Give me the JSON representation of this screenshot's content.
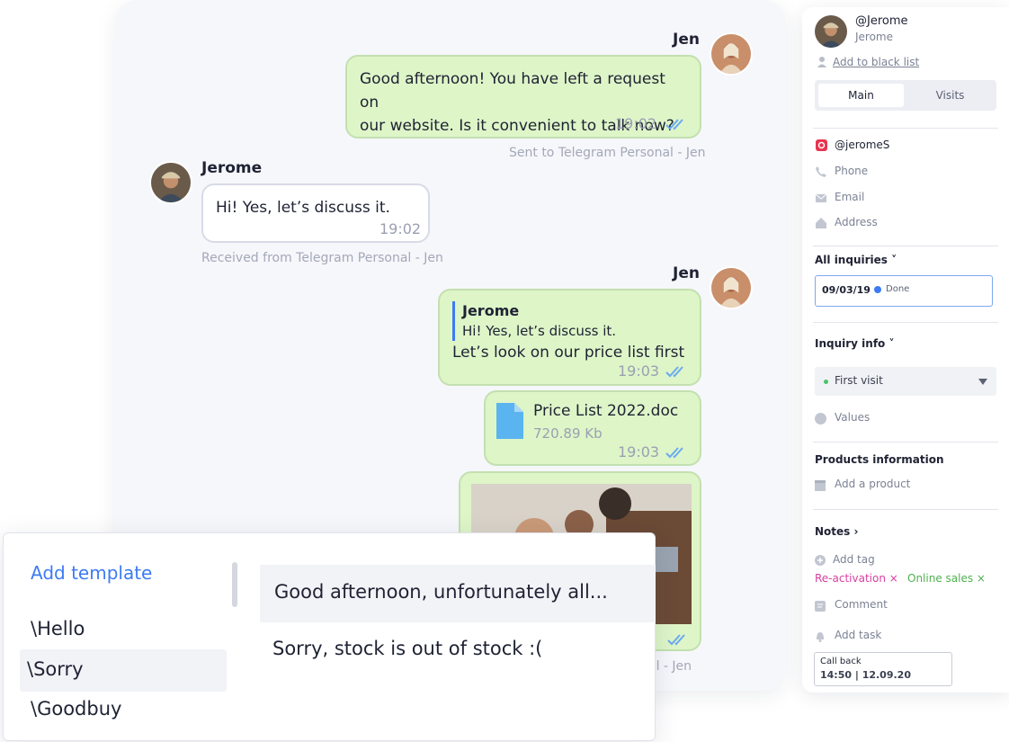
{
  "chat": {
    "messages": [
      {
        "sender": "Jen",
        "text": "Good afternoon! You have left a request on our website. Is it convenient to talk now?",
        "line1": "Good afternoon! You have left a request on",
        "line2": "our website. Is it convenient to talk now?",
        "time": "19:02",
        "meta": "Sent to Telegram Personal - Jen"
      },
      {
        "sender": "Jerome",
        "text": "Hi! Yes, let’s discuss it.",
        "time": "19:02",
        "meta": "Received from Telegram Personal - Jen"
      },
      {
        "sender": "Jen",
        "quote_author": "Jerome",
        "quote_text": "Hi! Yes, let’s discuss it.",
        "text": "Let’s look on our price list first",
        "time": "19:03"
      },
      {
        "file_name": "Price List 2022.doc",
        "file_size": "720.89 Kb",
        "time": "19:03"
      },
      {
        "meta_partial": "al - Jen"
      }
    ]
  },
  "sidebar": {
    "handle": "@Jerome",
    "name": "Jerome",
    "blacklist": "Add to black list",
    "tabs": [
      "Main",
      "Visits"
    ],
    "contacts": {
      "instagram": "@jeromeS",
      "phone": "Phone",
      "email": "Email",
      "address": "Address"
    },
    "inquiries_title": "All inquiries ˅",
    "inquiry": {
      "date": "09/03/19",
      "status": "Done"
    },
    "inquiry_info_title": "Inquiry info ˅",
    "visit_select": "First visit",
    "values": "Values",
    "products_title": "Products information",
    "add_product": "Add a product",
    "notes_title": "Notes ›",
    "add_tag": "Add tag",
    "tags": [
      "Re-activation ×",
      "Online sales ×"
    ],
    "comment": "Comment",
    "add_task": "Add task",
    "task": {
      "label": "Call back",
      "datetime": "14:50 | 12.09.20"
    }
  },
  "templates": {
    "add_label": "Add template",
    "commands": [
      "\\Hello",
      "\\Sorry",
      "\\Goodbuy"
    ],
    "previews": [
      "Good afternoon, unfortunately all...",
      "Sorry, stock is out of stock :("
    ]
  },
  "colors": {
    "accent": "#3d7bf5",
    "outgoing_bubble": "#def5c8",
    "tag_pink": "#d63fa0",
    "tag_green": "#4fb04f"
  }
}
